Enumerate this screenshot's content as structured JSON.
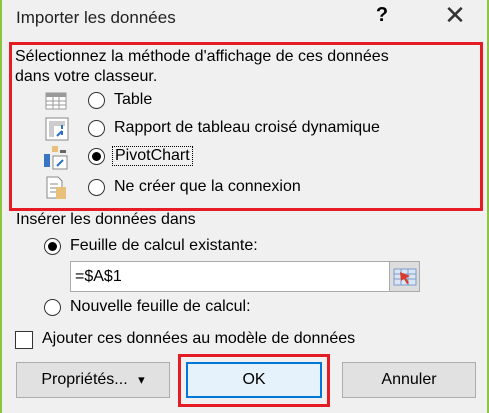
{
  "title": "Importer les données",
  "help_label": "?",
  "close_label": "✕",
  "prompt_line1": "Sélectionnez la méthode d'affichage de ces données",
  "prompt_line2": "dans votre classeur.",
  "view_options": [
    {
      "label": "Table",
      "icon": "table-icon",
      "selected": false
    },
    {
      "label": "Rapport de tableau croisé dynamique",
      "icon": "pivottable-icon",
      "selected": false
    },
    {
      "label": "PivotChart",
      "icon": "pivotchart-icon",
      "selected": true
    },
    {
      "label": "Ne créer que la connexion",
      "icon": "connection-only-icon",
      "selected": false
    }
  ],
  "insert_label": "Insérer les données dans",
  "existing_sheet_label": "Feuille de calcul existante:",
  "existing_sheet_selected": true,
  "cell_ref_value": "=$A$1",
  "new_sheet_label": "Nouvelle feuille de calcul:",
  "add_to_model_label": "Ajouter ces données au modèle de données",
  "add_to_model_checked": false,
  "buttons": {
    "properties": "Propriétés...",
    "properties_arrow": "▾",
    "ok": "OK",
    "cancel": "Annuler"
  },
  "colors": {
    "highlight": "#e51c23",
    "window_border": "#8cc63f"
  }
}
